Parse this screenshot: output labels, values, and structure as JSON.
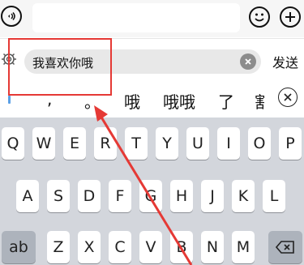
{
  "topbar": {
    "voice_icon": "voice-icon",
    "emoji_icon": "emoji-icon",
    "plus_icon": "plus-icon"
  },
  "compose": {
    "text": "我喜欢你哦",
    "send_label": "发送",
    "settings_icon": "gear-icon",
    "clear_icon": "clear-icon"
  },
  "candidates": [
    ",",
    "。",
    "哦",
    "哦哦",
    "了",
    "割"
  ],
  "keyboard": {
    "row1": [
      "Q",
      "W",
      "E",
      "R",
      "T",
      "Y",
      "U",
      "I",
      "O",
      "P"
    ],
    "row2": [
      "A",
      "S",
      "D",
      "F",
      "G",
      "H",
      "J",
      "K",
      "L"
    ],
    "row3": [
      "Z",
      "X",
      "C",
      "V",
      "B",
      "N",
      "M"
    ],
    "shift_label": "ab",
    "backspace_icon": "backspace-icon"
  },
  "annotation": {
    "color": "#e53935"
  }
}
